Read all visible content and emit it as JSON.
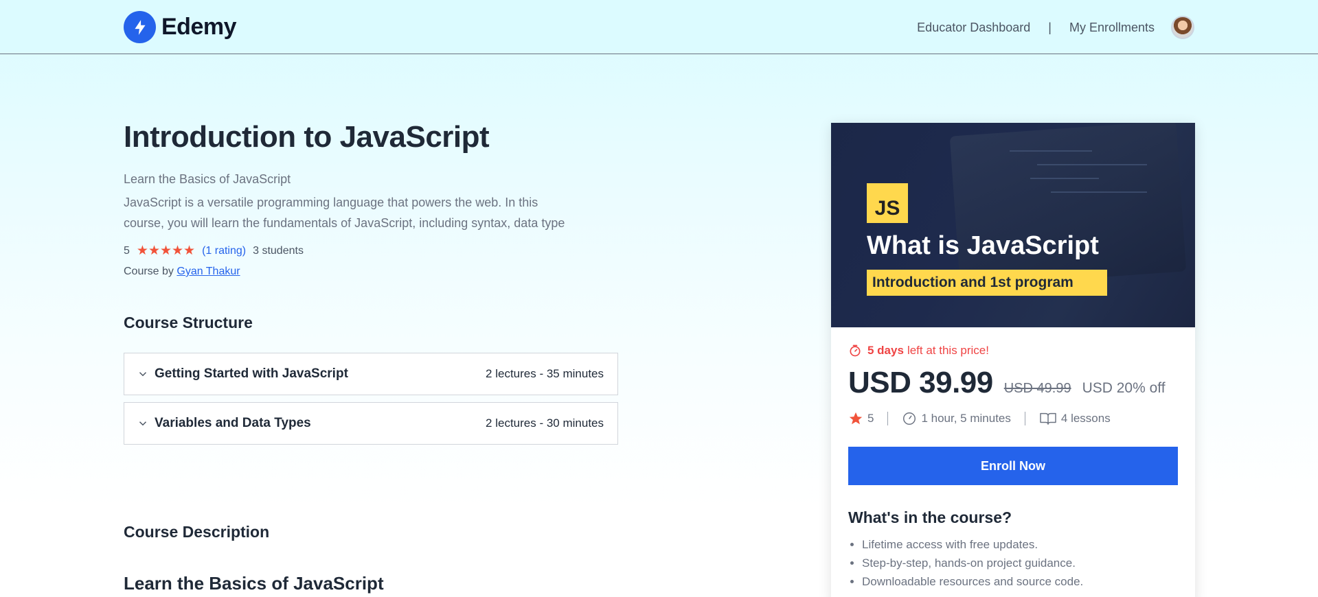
{
  "header": {
    "brand": "Edemy",
    "nav": {
      "educator_dashboard": "Educator Dashboard",
      "separator": "|",
      "my_enrollments": "My Enrollments"
    }
  },
  "course": {
    "title": "Introduction to JavaScript",
    "subtitle": "Learn the Basics of JavaScript",
    "description_line1": "JavaScript is a versatile programming language that powers the web. In this",
    "description_line2": "course, you will learn the fundamentals of JavaScript, including syntax, data type",
    "rating": "5",
    "stars": "★★★★★",
    "rating_count": "(1 rating)",
    "students": "3 students",
    "by_label": "Course by",
    "educator": "Gyan Thakur"
  },
  "structure": {
    "title": "Course Structure",
    "chapters": [
      {
        "name": "Getting Started with JavaScript",
        "meta": "2 lectures - 35 minutes"
      },
      {
        "name": "Variables and Data Types",
        "meta": "2 lectures - 30 minutes"
      }
    ]
  },
  "description_section": {
    "title": "Course Description",
    "heading": "Learn the Basics of JavaScript"
  },
  "card": {
    "thumbnail": {
      "badge": "JS",
      "title": "What is JavaScript",
      "subtitle": "Introduction and 1st program"
    },
    "timer_bold": "5 days",
    "timer_rest": "left at this price!",
    "price": "USD 39.99",
    "old_price": "USD 49.99",
    "discount": "USD 20% off",
    "stats": {
      "rating": "5",
      "duration": "1 hour, 5 minutes",
      "lessons": "4 lessons"
    },
    "enroll_label": "Enroll Now",
    "includes_title": "What's in the course?",
    "includes": [
      "Lifetime access with free updates.",
      "Step-by-step, hands-on project guidance.",
      "Downloadable resources and source code."
    ]
  },
  "colors": {
    "accent": "#2563eb",
    "star": "#f1533a",
    "timer": "#ef4444",
    "thumbnail_bg": "#1e2a4d",
    "badge": "#ffd84d"
  }
}
